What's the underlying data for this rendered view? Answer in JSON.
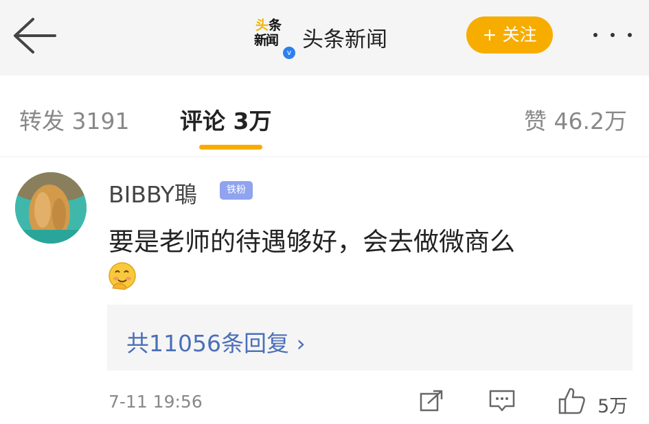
{
  "header": {
    "logo_line1_a": "头",
    "logo_line1_b": "条",
    "logo_line2": "新闻",
    "verified_mark": "v",
    "title": "头条新闻",
    "follow_label": "+ 关注"
  },
  "tabs": {
    "repost": "转发 3191",
    "comments": "评论 3万",
    "likes": "赞 46.2万"
  },
  "comment": {
    "username": "BIBBY鵈",
    "badge": "铁粉",
    "text": "要是老师的待遇够好，会去做微商么",
    "emoji": "smiling-face-with-hand-emoji",
    "replies_label": "共11056条回复 ›",
    "timestamp": "7-11 19:56",
    "like_count": "5万"
  },
  "colors": {
    "accent": "#f7ad00",
    "link_blue": "#4b6fb8",
    "badge": "#8fa3ee",
    "verified": "#2e7ff0"
  }
}
